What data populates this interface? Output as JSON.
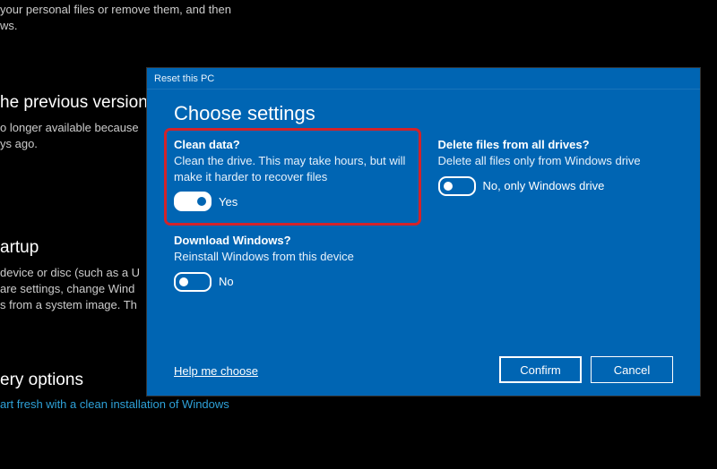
{
  "background": {
    "top_fragment_line1": "your personal files or remove them, and then",
    "top_fragment_line2": "ws.",
    "prev_heading": "he previous version",
    "prev_line1": "o longer available because",
    "prev_line2": "ys ago.",
    "startup_heading": "artup",
    "startup_line1": "device or disc (such as a U",
    "startup_line2": "are settings, change Wind",
    "startup_line3": "s from a system image. Th",
    "recovery_heading": "ery options",
    "recovery_link": "art fresh with a clean installation of Windows"
  },
  "dialog": {
    "titlebar": "Reset this PC",
    "heading": "Choose settings",
    "settings": {
      "clean": {
        "title": "Clean data?",
        "desc": "Clean the drive. This may take hours, but will make it harder to recover files",
        "value_label": "Yes",
        "on": true
      },
      "delete_drives": {
        "title": "Delete files from all drives?",
        "desc": "Delete all files only from Windows drive",
        "value_label": "No, only Windows drive",
        "on": false
      },
      "download": {
        "title": "Download Windows?",
        "desc": "Reinstall Windows from this device",
        "value_label": "No",
        "on": false
      }
    },
    "help_link": "Help me choose",
    "buttons": {
      "confirm": "Confirm",
      "cancel": "Cancel"
    }
  },
  "annotation": {
    "highlight_target": "clean-data-setting"
  }
}
